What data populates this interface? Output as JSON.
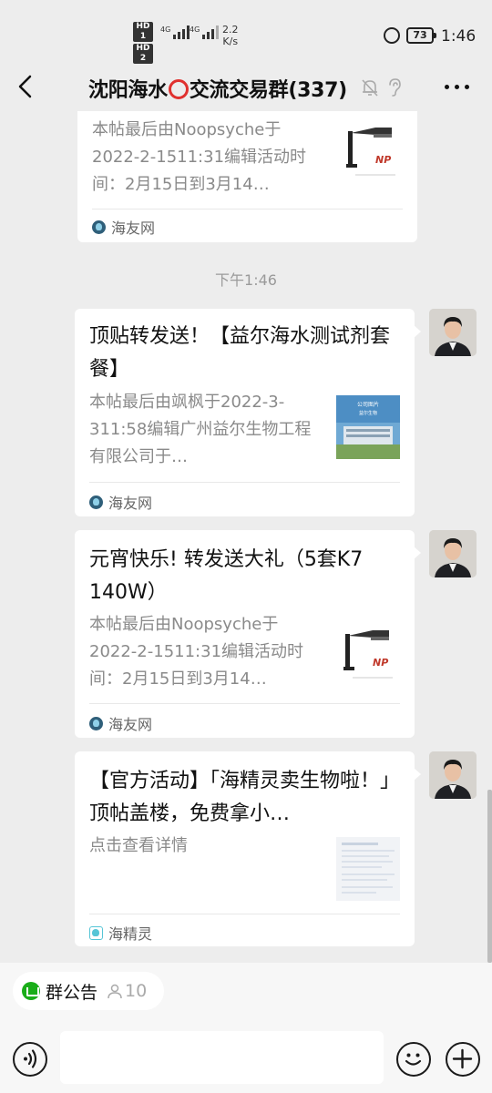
{
  "status_bar": {
    "network_speed": "2.2",
    "network_unit": "K/s",
    "signal_1_label": "4G",
    "signal_2_label": "4G",
    "hd_1": "HD 1",
    "hd_2": "HD 2",
    "battery": "73",
    "time": "1:46"
  },
  "navbar": {
    "title_before": "沈阳海水",
    "title_after": "交流交易群(337)",
    "icons": [
      "back-icon",
      "bell-muted-icon",
      "ear-icon",
      "more-icon"
    ]
  },
  "messages": [
    {
      "type": "link-card",
      "desc": "本帖最后由Noopsyche于2022-2-1511:31编辑活动时间：2月15日到3月14…",
      "source": "海友网",
      "thumb": "lamp"
    },
    {
      "type": "timestamp",
      "text": "下午1:46"
    },
    {
      "type": "link-card",
      "title": "顶贴转发送！【益尔海水测试剂套餐】",
      "desc": "本帖最后由飒枫于2022-3-311:58编辑广州益尔生物工程有限公司于…",
      "source": "海友网",
      "thumb": "building"
    },
    {
      "type": "link-card",
      "title": "元宵快乐! 转发送大礼（5套K7 140W）",
      "desc": "本帖最后由Noopsyche于2022-2-1511:31编辑活动时间：2月15日到3月14…",
      "source": "海友网",
      "thumb": "lamp"
    },
    {
      "type": "link-card",
      "title": "【官方活动】「海精灵卖生物啦！」顶帖盖楼，免费拿小…",
      "desc": "点击查看详情",
      "source": "海精灵",
      "thumb": "document"
    }
  ],
  "bottom": {
    "notice_label": "群公告",
    "notice_count": "10",
    "input_placeholder": ""
  },
  "colors": {
    "background": "#ededed",
    "bubble": "#ffffff",
    "accent_green": "#1aad19",
    "ring_red": "#e0312f"
  }
}
